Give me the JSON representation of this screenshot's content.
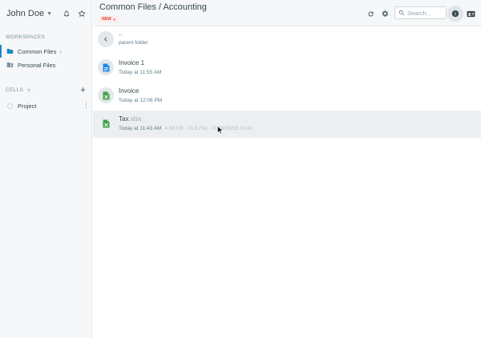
{
  "sidebar": {
    "user_name": "John Doe",
    "workspaces_label": "WORKSPACES",
    "workspaces": [
      {
        "label": "Common Files",
        "icon": "folder-icon",
        "active": true
      },
      {
        "label": "Personal Files",
        "icon": "folder-user-icon",
        "active": false
      }
    ],
    "cells_label": "CELLS",
    "add_cell": "+",
    "cells": [
      {
        "label": "Project",
        "icon": "cell-icon"
      }
    ]
  },
  "header": {
    "breadcrumb": "Common Files / Accounting",
    "new_badge": "NEW",
    "search_placeholder": "Search..."
  },
  "files": [
    {
      "name": "..",
      "ext": "",
      "meta": "parent folder",
      "meta_extra": "",
      "icon": "back-icon"
    },
    {
      "name": "Invoice 1",
      "ext": "",
      "meta": "Today at 11:55 AM",
      "meta_extra": "",
      "icon": "word-doc-icon"
    },
    {
      "name": "Invoice",
      "ext": "",
      "meta": "Today at 12:06 PM",
      "meta_extra": "",
      "icon": "excel-icon"
    },
    {
      "name": "Tax",
      "ext": ".xlsx",
      "meta": "Today at 11:43 AM",
      "meta_extra": "4.08 KB · XLS File · 2018/06/15 11:43",
      "icon": "excel-icon"
    }
  ],
  "colors": {
    "accent": "#1e88c7",
    "excel": "#43a047",
    "word": "#1e88e5",
    "badge": "#e53935"
  }
}
